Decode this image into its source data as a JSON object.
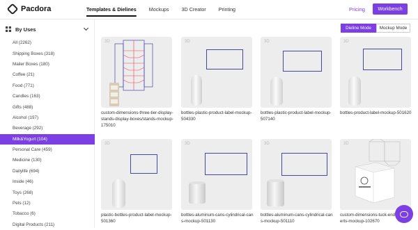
{
  "header": {
    "brand": "Pacdora",
    "nav": [
      "Templates & Dielines",
      "Mockups",
      "3D Creator",
      "Printing"
    ],
    "pricing": "Pricing",
    "workbench": "Workbench"
  },
  "sidebar": {
    "title": "By Uses",
    "categories": [
      "All (2262)",
      "Shipping Boxes (318)",
      "Mailer Boxes (180)",
      "Coffee (21)",
      "Food (771)",
      "Candles (163)",
      "Gifts (488)",
      "Alcohol (197)",
      "Beverage (292)",
      "Milk&Yogurt (104)",
      "Personal Care (459)",
      "Medicine (130)",
      "Dailylife (694)",
      "Inside (46)",
      "Toys (268)",
      "Pets (12)",
      "Tobacco (6)",
      "Digital Products (211)"
    ],
    "active_index": 9
  },
  "modes": {
    "dieline": "Dieline Mode",
    "mockup": "Mockup Mode"
  },
  "cards": [
    {
      "tag": "3D",
      "label": "custom-dimensions-three-tier-display-stands-display-boxes/stands-mockup-175010"
    },
    {
      "tag": "3D",
      "label": "bottles-plastic-product-label-mockup-504330"
    },
    {
      "tag": "3D",
      "label": "bottles-plastic-product-label-mockup-507140"
    },
    {
      "tag": "3D",
      "label": "bottles-product-label-mockup-501620"
    },
    {
      "tag": "3D",
      "label": "plastic-bottles-product-label-mockup-501360"
    },
    {
      "tag": "3D",
      "label": "bottles-aluminum-cans-cylindrical-cans-mockup-501130"
    },
    {
      "tag": "3D",
      "label": "bottles-aluminum-cans-cylindrical-cans-mockup-501110"
    },
    {
      "tag": "3D",
      "label": "custom-dimensions-tuck-end-lock-inserts-mockup-102670"
    }
  ],
  "colors": {
    "accent": "#7b3fe4",
    "dieline_frame": "#4646a8",
    "dieline_red": "#e0464f"
  }
}
